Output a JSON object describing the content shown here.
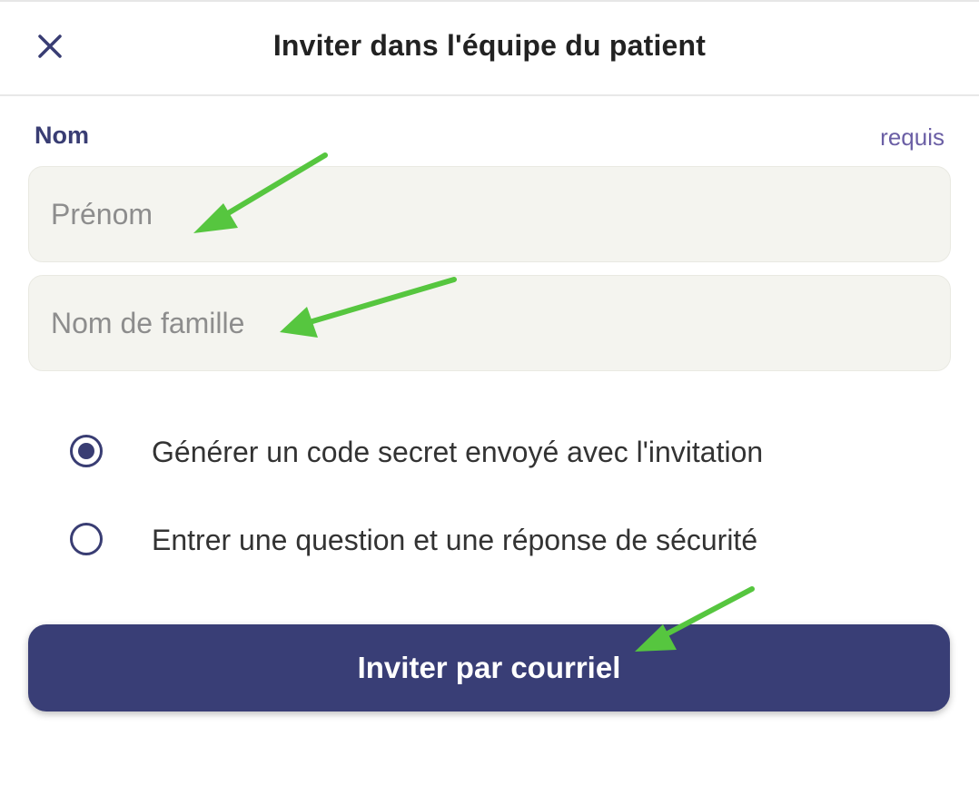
{
  "header": {
    "title": "Inviter dans l'équipe du patient",
    "close_icon": "close-icon"
  },
  "form": {
    "name_label": "Nom",
    "required_label": "requis",
    "first_name": {
      "value": "",
      "placeholder": "Prénom"
    },
    "last_name": {
      "value": "",
      "placeholder": "Nom de famille"
    },
    "options": [
      {
        "label": "Générer un code secret envoyé avec l'invitation",
        "selected": true
      },
      {
        "label": "Entrer une question et une réponse de sécurité",
        "selected": false
      }
    ],
    "submit_label": "Inviter par courriel"
  },
  "colors": {
    "primary": "#393e76",
    "field_bg": "#f4f4ef",
    "annotation_arrow": "#56c63f",
    "required_text": "#6b5fa5"
  }
}
